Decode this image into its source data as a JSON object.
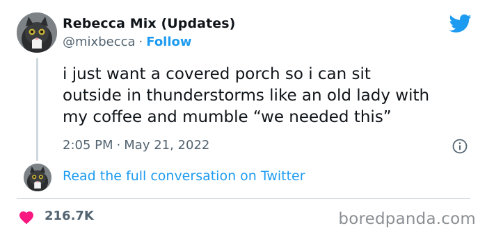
{
  "author": {
    "name": "Rebecca Mix (Updates)",
    "handle": "@mixbecca",
    "separator": "·",
    "follow_label": "Follow"
  },
  "tweet": {
    "lines": [
      "i just want a covered porch so i can sit",
      "outside in thunderstorms like an old lady with",
      "my coffee and mumble “we needed this”"
    ],
    "time": "2:05 PM",
    "separator": "·",
    "date": "May 21, 2022"
  },
  "conversation_link": "Read the full conversation on Twitter",
  "likes_count": "216.7K",
  "watermark": "boredpanda.com",
  "colors": {
    "twitter_blue": "#1d9bf0",
    "heart_pink": "#f91880",
    "secondary_text": "#536471",
    "divider": "#cfd9de"
  },
  "icons": [
    "twitter-bird-icon",
    "info-icon",
    "heart-icon"
  ]
}
